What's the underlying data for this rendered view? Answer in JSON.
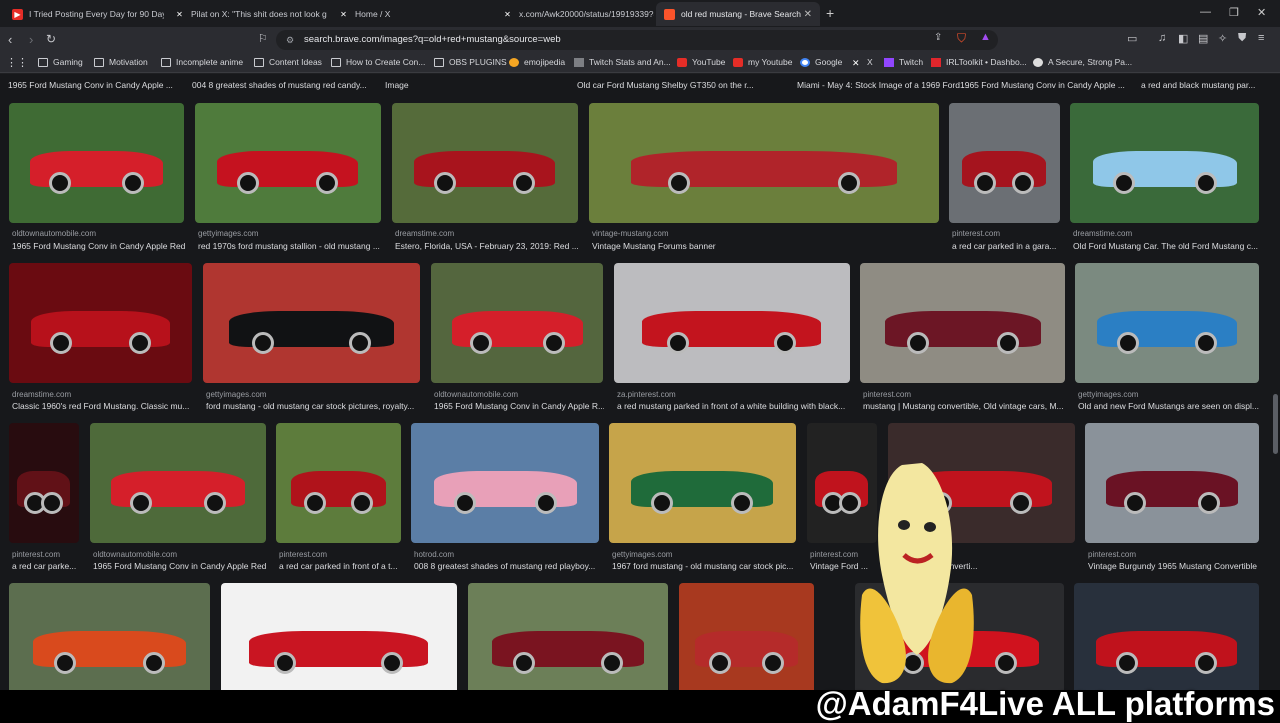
{
  "tabs": [
    {
      "title": "I Tried Posting Every Day for 90 Days",
      "icon": "youtube-icon",
      "active": false
    },
    {
      "title": "Pilat on X: \"This shit does not look g",
      "icon": "x-icon",
      "active": false
    },
    {
      "title": "Home / X",
      "icon": "x-icon",
      "active": false
    },
    {
      "title": "x.com/Awk20000/status/19919339?8",
      "icon": "x-icon",
      "active": false
    },
    {
      "title": "old red mustang - Brave Search",
      "icon": "brave-icon",
      "active": true
    }
  ],
  "toolbar": {
    "url": "search.brave.com/images?q=old+red+mustang&source=web"
  },
  "bookmarks": [
    {
      "label": "Gaming",
      "icon": "folder-icon"
    },
    {
      "label": "Motivation",
      "icon": "folder-icon"
    },
    {
      "label": "Incomplete anime",
      "icon": "folder-icon"
    },
    {
      "label": "Content Ideas",
      "icon": "folder-icon"
    },
    {
      "label": "How to Create Con...",
      "icon": "folder-icon"
    },
    {
      "label": "OBS PLUGINS",
      "icon": "folder-icon"
    },
    {
      "label": "emojipedia",
      "icon": "emojipedia-icon"
    },
    {
      "label": "Twitch Stats and An...",
      "icon": "twitch-stats-icon"
    },
    {
      "label": "YouTube",
      "icon": "youtube-icon"
    },
    {
      "label": "my Youtube",
      "icon": "youtube-icon"
    },
    {
      "label": "Google",
      "icon": "google-icon"
    },
    {
      "label": "X",
      "icon": "x-icon"
    },
    {
      "label": "Twitch",
      "icon": "twitch-icon"
    },
    {
      "label": "IRLToolkit • Dashbo...",
      "icon": "irltoolkit-icon"
    },
    {
      "label": "A Secure, Strong Pa...",
      "icon": "info-icon"
    }
  ],
  "top_captions": [
    "1965 Ford Mustang Conv in Candy Apple ...",
    "004 8 greatest shades of mustang red candy...",
    "Image",
    "Old car Ford Mustang Shelby GT350 on the r...",
    "Miami - May 4: Stock Image of a 1969 Ford ...",
    "1965 Ford Mustang Conv in Candy Apple ...",
    "a red and black mustang par..."
  ],
  "rows": [
    [
      {
        "source": "oldtownautomobile.com",
        "caption": "1965 Ford Mustang Conv in Candy Apple Red",
        "color": "#d51f2a",
        "bg": "#3f6b34"
      },
      {
        "source": "gettyimages.com",
        "caption": "red 1970s ford mustang stallion - old mustang ...",
        "color": "#c5121f",
        "bg": "#4f7b3c"
      },
      {
        "source": "dreamstime.com",
        "caption": "Estero, Florida, USA - February 23, 2019: Red ...",
        "color": "#a8141d",
        "bg": "#556b3a"
      },
      {
        "source": "vintage-mustang.com",
        "caption": "Vintage Mustang Forums banner",
        "color": "#b0242a",
        "bg": "#6b7f3c"
      },
      {
        "source": "pinterest.com",
        "caption": "a red car parked in a gara...",
        "color": "#a5141e",
        "bg": "#6b6f74"
      },
      {
        "source": "dreamstime.com",
        "caption": "Old Ford Mustang Car. The old Ford Mustang c...",
        "color": "#8fc7e8",
        "bg": "#3a6a3a"
      }
    ],
    [
      {
        "source": "dreamstime.com",
        "caption": "Classic 1960's red Ford Mustang. Classic mu...",
        "color": "#b7111b",
        "bg": "#6a0b11"
      },
      {
        "source": "gettyimages.com",
        "caption": "ford mustang - old mustang car stock pictures, royalty...",
        "color": "#111214",
        "bg": "#b03630"
      },
      {
        "source": "oldtownautomobile.com",
        "caption": "1965 Ford Mustang Conv in Candy Apple R...",
        "color": "#d51f2a",
        "bg": "#54663e"
      },
      {
        "source": "za.pinterest.com",
        "caption": "a red mustang parked in front of a white building with black...",
        "color": "#c3141e",
        "bg": "#bcbcbf"
      },
      {
        "source": "pinterest.com",
        "caption": "mustang | Mustang convertible, Old vintage cars, M...",
        "color": "#6c1625",
        "bg": "#8f8c83"
      },
      {
        "source": "gettyimages.com",
        "caption": "Old and new Ford Mustangs are seen on displ...",
        "color": "#2b7fc4",
        "bg": "#7b8a80"
      }
    ],
    [
      {
        "source": "pinterest.com",
        "caption": "a red car parke...",
        "color": "#611117",
        "bg": "#280c0f"
      },
      {
        "source": "oldtownautomobile.com",
        "caption": "1965 Ford Mustang Conv in Candy Apple Red",
        "color": "#d51f2a",
        "bg": "#4e6a3a"
      },
      {
        "source": "pinterest.com",
        "caption": "a red car parked in front of a t...",
        "color": "#b0131b",
        "bg": "#5d7c3c"
      },
      {
        "source": "hotrod.com",
        "caption": "008 8 greatest shades of mustang red playboy...",
        "color": "#e8a0b8",
        "bg": "#5b7ea6"
      },
      {
        "source": "gettyimages.com",
        "caption": "1967 ford mustang - old mustang car stock pic...",
        "color": "#1f6b3a",
        "bg": "#c6a44a"
      },
      {
        "source": "pinterest.com",
        "caption": "Vintage Ford ...",
        "color": "#c0131d",
        "bg": "#222"
      },
      {
        "source": "",
        "caption": "...ssic sporty converti...",
        "color": "#c0131d",
        "bg": "#3a2b2b"
      },
      {
        "source": "pinterest.com",
        "caption": "Vintage Burgundy 1965 Mustang Convertible",
        "color": "#6a1224",
        "bg": "#8a929a"
      }
    ],
    [
      {
        "source": "",
        "caption": "",
        "color": "#d94a1d",
        "bg": "#5c6e4f"
      },
      {
        "source": "",
        "caption": "",
        "color": "#c91522",
        "bg": "#f2f2f2"
      },
      {
        "source": "",
        "caption": "",
        "color": "#7a1420",
        "bg": "#6c7f58"
      },
      {
        "source": "",
        "caption": "",
        "color": "#b52b2a",
        "bg": "#a8391f"
      },
      {
        "source": "",
        "caption": "",
        "color": "#d0121e",
        "bg": "#2a2b2e"
      },
      {
        "source": "",
        "caption": "",
        "color": "#c0121c",
        "bg": "#28303c"
      }
    ]
  ],
  "overlay": {
    "banner_text": "@AdamF4Live ALL platforms",
    "mascot": "banana-mascot-icon"
  },
  "colors": {
    "accent": "#fb542b",
    "background": "#17181b"
  }
}
